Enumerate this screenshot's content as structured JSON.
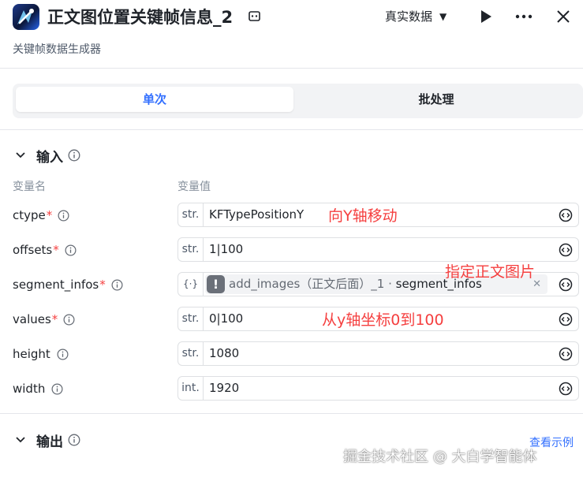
{
  "header": {
    "title": "正文图位置关键帧信息_2",
    "subtitle": "关键帧数据生成器",
    "data_mode": "真实数据"
  },
  "tabs": [
    {
      "label": "单次",
      "active": true
    },
    {
      "label": "批处理",
      "active": false
    }
  ],
  "input_section": {
    "title": "输入",
    "col_name": "变量名",
    "col_value": "变量值",
    "fields": [
      {
        "name": "ctype",
        "required": "*",
        "type": "str.",
        "value": "KFTypePositionY"
      },
      {
        "name": "offsets",
        "required": "*",
        "type": "str.",
        "value": "1|100"
      },
      {
        "name": "segment_infos",
        "required": "*",
        "type": "{⋅}",
        "ref": {
          "prefix": "add_images（正文后面）_1 · ",
          "field": "segment_infos"
        }
      },
      {
        "name": "values",
        "required": "*",
        "type": "str.",
        "value": "0|100"
      },
      {
        "name": "height",
        "required": "",
        "type": "str.",
        "value": "1080"
      },
      {
        "name": "width",
        "required": "",
        "type": "int.",
        "value": "1920"
      }
    ]
  },
  "annotations": {
    "ctype": "向Y轴移动",
    "segment_infos": "指定正文图片",
    "values": "从y轴坐标0到100"
  },
  "output_section": {
    "title": "输出",
    "example_link": "查看示例"
  },
  "watermark": "掘金技术社区 @ 大白学智能体",
  "colors": {
    "accent": "#3370ff",
    "required": "#f53f3f",
    "annotation": "#f53f3f"
  }
}
